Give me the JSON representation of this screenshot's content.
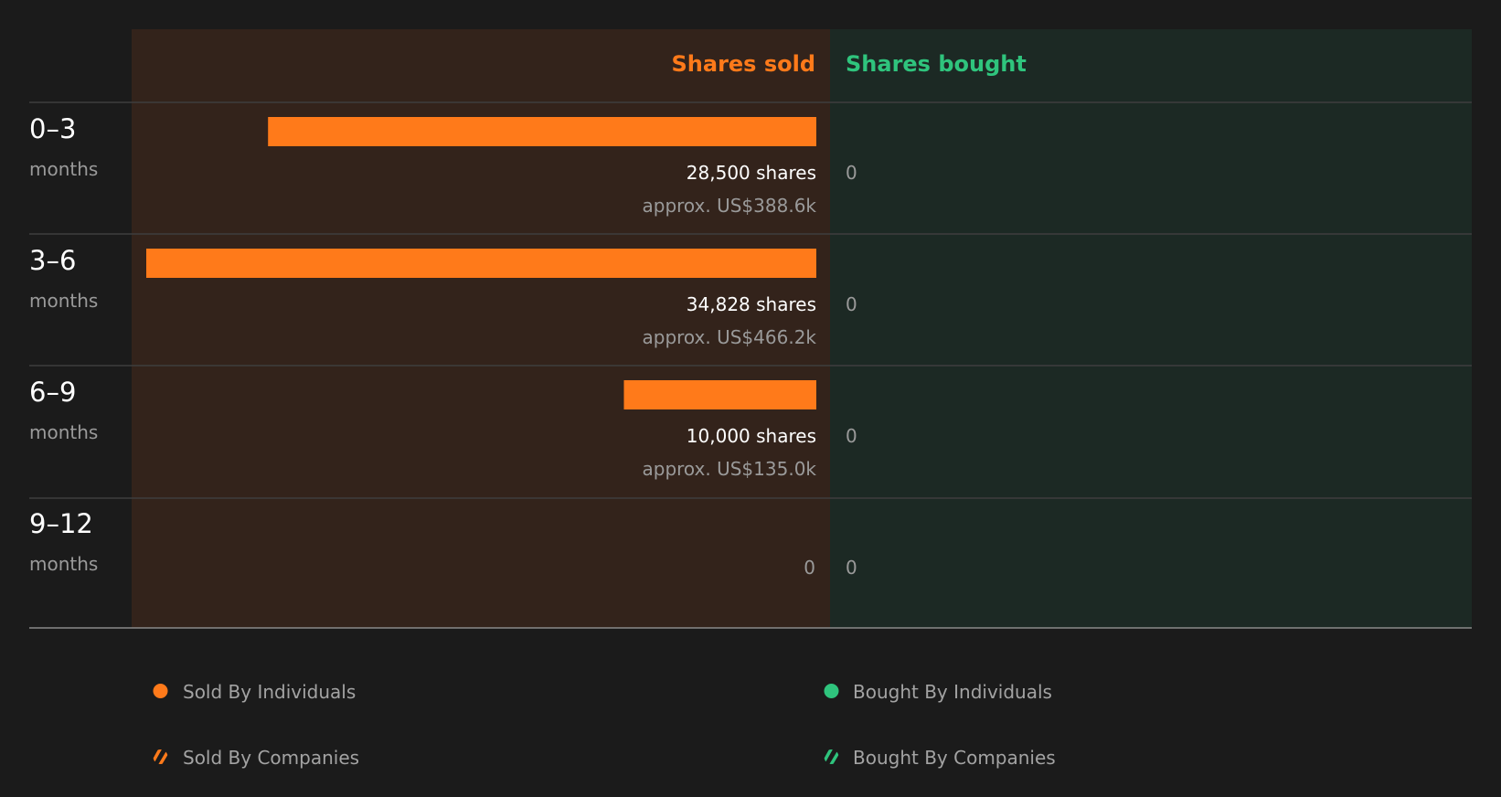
{
  "colors": {
    "sold": "#ff7a1a",
    "bought": "#2fc47d",
    "background": "#1b1b1b",
    "sold_panel": "#33231b",
    "bought_panel": "#1c2924"
  },
  "chart_data": {
    "type": "bar",
    "orientation": "horizontal-diverging",
    "headers": {
      "sold": "Shares sold",
      "bought": "Shares bought"
    },
    "max_sold": 34828,
    "rows": [
      {
        "range": "0–3",
        "unit": "months",
        "sold_shares": 28500,
        "sold_shares_label": "28,500 shares",
        "sold_usd_label": "approx. US$388.6k",
        "bought_shares": 0,
        "bought_label": "0"
      },
      {
        "range": "3–6",
        "unit": "months",
        "sold_shares": 34828,
        "sold_shares_label": "34,828 shares",
        "sold_usd_label": "approx. US$466.2k",
        "bought_shares": 0,
        "bought_label": "0"
      },
      {
        "range": "6–9",
        "unit": "months",
        "sold_shares": 10000,
        "sold_shares_label": "10,000 shares",
        "sold_usd_label": "approx. US$135.0k",
        "bought_shares": 0,
        "bought_label": "0"
      },
      {
        "range": "9–12",
        "unit": "months",
        "sold_shares": 0,
        "sold_shares_label": "0",
        "sold_usd_label": "",
        "bought_shares": 0,
        "bought_label": "0"
      }
    ],
    "legend": [
      {
        "label": "Sold By Individuals",
        "color": "#ff7a1a",
        "marker": "dot"
      },
      {
        "label": "Bought By Individuals",
        "color": "#2fc47d",
        "marker": "dot"
      },
      {
        "label": "Sold By Companies",
        "color": "#ff7a1a",
        "marker": "striped-dot"
      },
      {
        "label": "Bought By Companies",
        "color": "#2fc47d",
        "marker": "striped-dot"
      }
    ]
  }
}
